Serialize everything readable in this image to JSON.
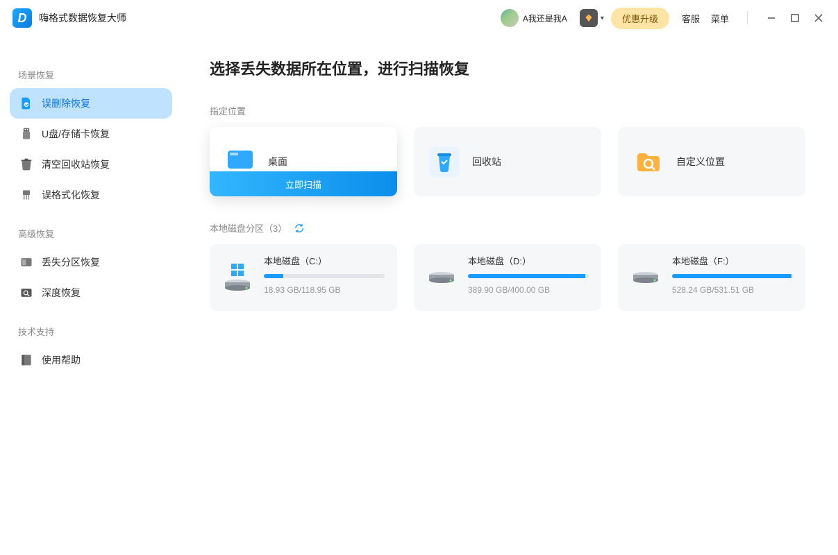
{
  "app": {
    "title": "嗨格式数据恢复大师"
  },
  "header": {
    "username": "A我还是我A",
    "upgrade": "优惠升级",
    "support": "客服",
    "menu": "菜单"
  },
  "sidebar": {
    "sections": {
      "scene": "场景恢复",
      "advanced": "高级恢复",
      "support": "技术支持"
    },
    "items": {
      "delete_recovery": "误删除恢复",
      "usb_recovery": "U盘/存储卡恢复",
      "recyclebin_recovery": "清空回收站恢复",
      "format_recovery": "误格式化恢复",
      "partition_recovery": "丢失分区恢复",
      "deep_recovery": "深度恢复",
      "help": "使用帮助"
    }
  },
  "main": {
    "heading": "选择丢失数据所在位置，进行扫描恢复",
    "locations_label": "指定位置",
    "scan_now": "立即扫描",
    "locations": {
      "desktop": "桌面",
      "recyclebin": "回收站",
      "custom": "自定义位置"
    },
    "disks_label": "本地磁盘分区（3）",
    "disks": [
      {
        "name": "本地磁盘（C:）",
        "size": "18.93 GB/118.95 GB",
        "pct": 16
      },
      {
        "name": "本地磁盘（D:）",
        "size": "389.90 GB/400.00 GB",
        "pct": 97
      },
      {
        "name": "本地磁盘（F:）",
        "size": "528.24 GB/531.51 GB",
        "pct": 99
      }
    ]
  }
}
